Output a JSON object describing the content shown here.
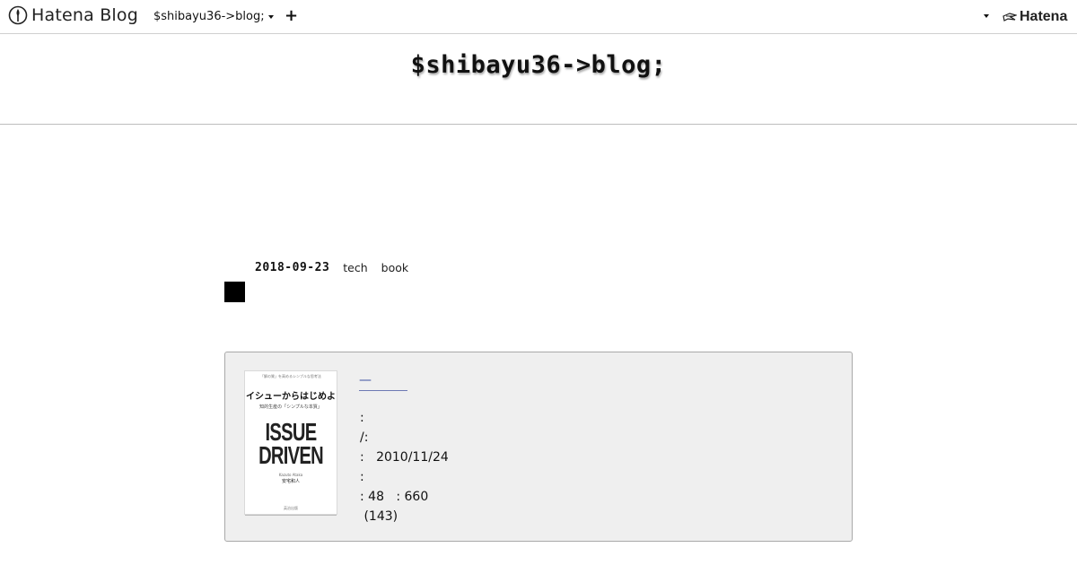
{
  "topbar": {
    "brand_name": "Hatena Blog",
    "blog_selector_label": "$shibayu36->blog;",
    "new_post_label": "+",
    "hatena_logo_text": "Hatena"
  },
  "blog": {
    "title": "$shibayu36->blog;"
  },
  "entry": {
    "date": "2018-09-23",
    "categories": [
      "tech",
      "book"
    ]
  },
  "book_card": {
    "cover": {
      "top_note": "「解の質」を高めるシンプルな思考法",
      "title_jp": "イシューからはじめよ",
      "subtitle_jp": "知的生産の「シンプルな本質」",
      "title_en_line1": "ISSUE",
      "title_en_line2": "DRIVEN",
      "author_en": "Kazuto Ataka",
      "author_jp": "安宅和人",
      "publisher": "英治出版"
    },
    "title_link": "—",
    "details": [
      ":",
      "/:",
      ":   2010/11/24",
      ":",
      ": 48   : 660",
      " (143)"
    ]
  }
}
